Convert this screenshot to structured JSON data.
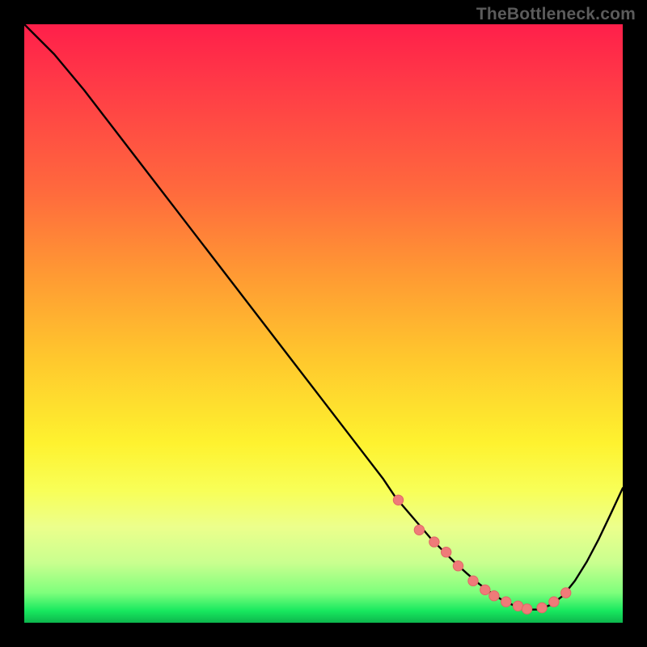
{
  "watermark": "TheBottleneck.com",
  "colors": {
    "background": "#000000",
    "curve": "#000000",
    "dot_fill": "#ef7b79",
    "dot_stroke": "#e06866"
  },
  "chart_data": {
    "type": "line",
    "title": "",
    "xlabel": "",
    "ylabel": "",
    "xlim": [
      0,
      100
    ],
    "ylim": [
      0,
      100
    ],
    "grid": false,
    "legend": false,
    "series": [
      {
        "name": "curve",
        "x": [
          0,
          5,
          10,
          15,
          20,
          25,
          30,
          35,
          40,
          45,
          50,
          55,
          60,
          62,
          65,
          68,
          70,
          72,
          74,
          76,
          78,
          80,
          82,
          84,
          86,
          88,
          90,
          92,
          94,
          96,
          98,
          100
        ],
        "y": [
          100,
          95,
          89,
          82.5,
          76,
          69.5,
          63,
          56.5,
          50,
          43.5,
          37,
          30.5,
          24,
          21,
          17.5,
          14,
          12,
          10,
          8.2,
          6.5,
          5,
          3.7,
          2.8,
          2.2,
          2.2,
          3,
          4.5,
          7,
          10.2,
          14,
          18.2,
          22.5
        ]
      }
    ],
    "highlight_dots": {
      "name": "cluster",
      "x": [
        62.5,
        66,
        68.5,
        70.5,
        72.5,
        75,
        77,
        78.5,
        80.5,
        82.5,
        84,
        86.5,
        88.5,
        90.5
      ],
      "y": [
        20.5,
        15.5,
        13.5,
        11.8,
        9.5,
        7,
        5.5,
        4.5,
        3.5,
        2.8,
        2.3,
        2.5,
        3.5,
        5
      ]
    }
  }
}
